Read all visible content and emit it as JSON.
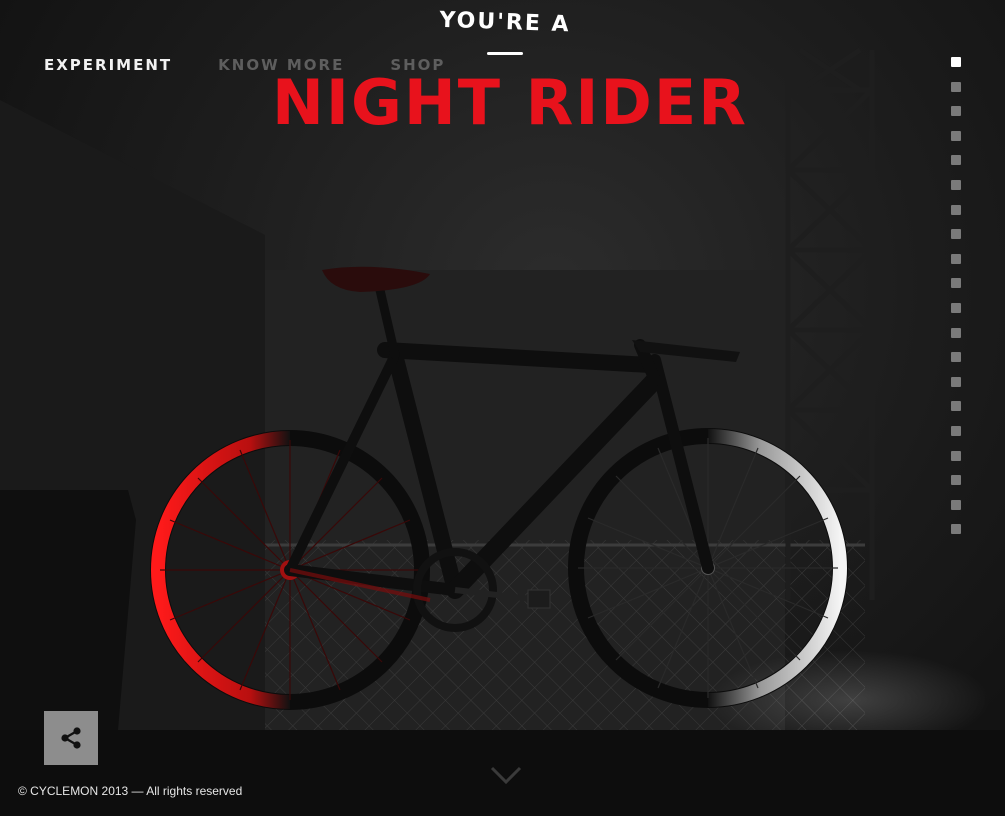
{
  "nav": {
    "items": [
      {
        "label": "EXPERIMENT",
        "active": true
      },
      {
        "label": "KNOW MORE",
        "active": false
      },
      {
        "label": "SHOP",
        "active": false
      }
    ]
  },
  "hero": {
    "kicker": "YOU'RE A",
    "headline": "NIGHT RIDER",
    "accent_color": "#e8121c"
  },
  "pager": {
    "count": 20,
    "active_index": 0
  },
  "footer": {
    "copyright": "© CYCLEMON 2013 — All rights reserved"
  },
  "icons": {
    "share": "share-icon",
    "scroll": "chevron-down-icon"
  }
}
